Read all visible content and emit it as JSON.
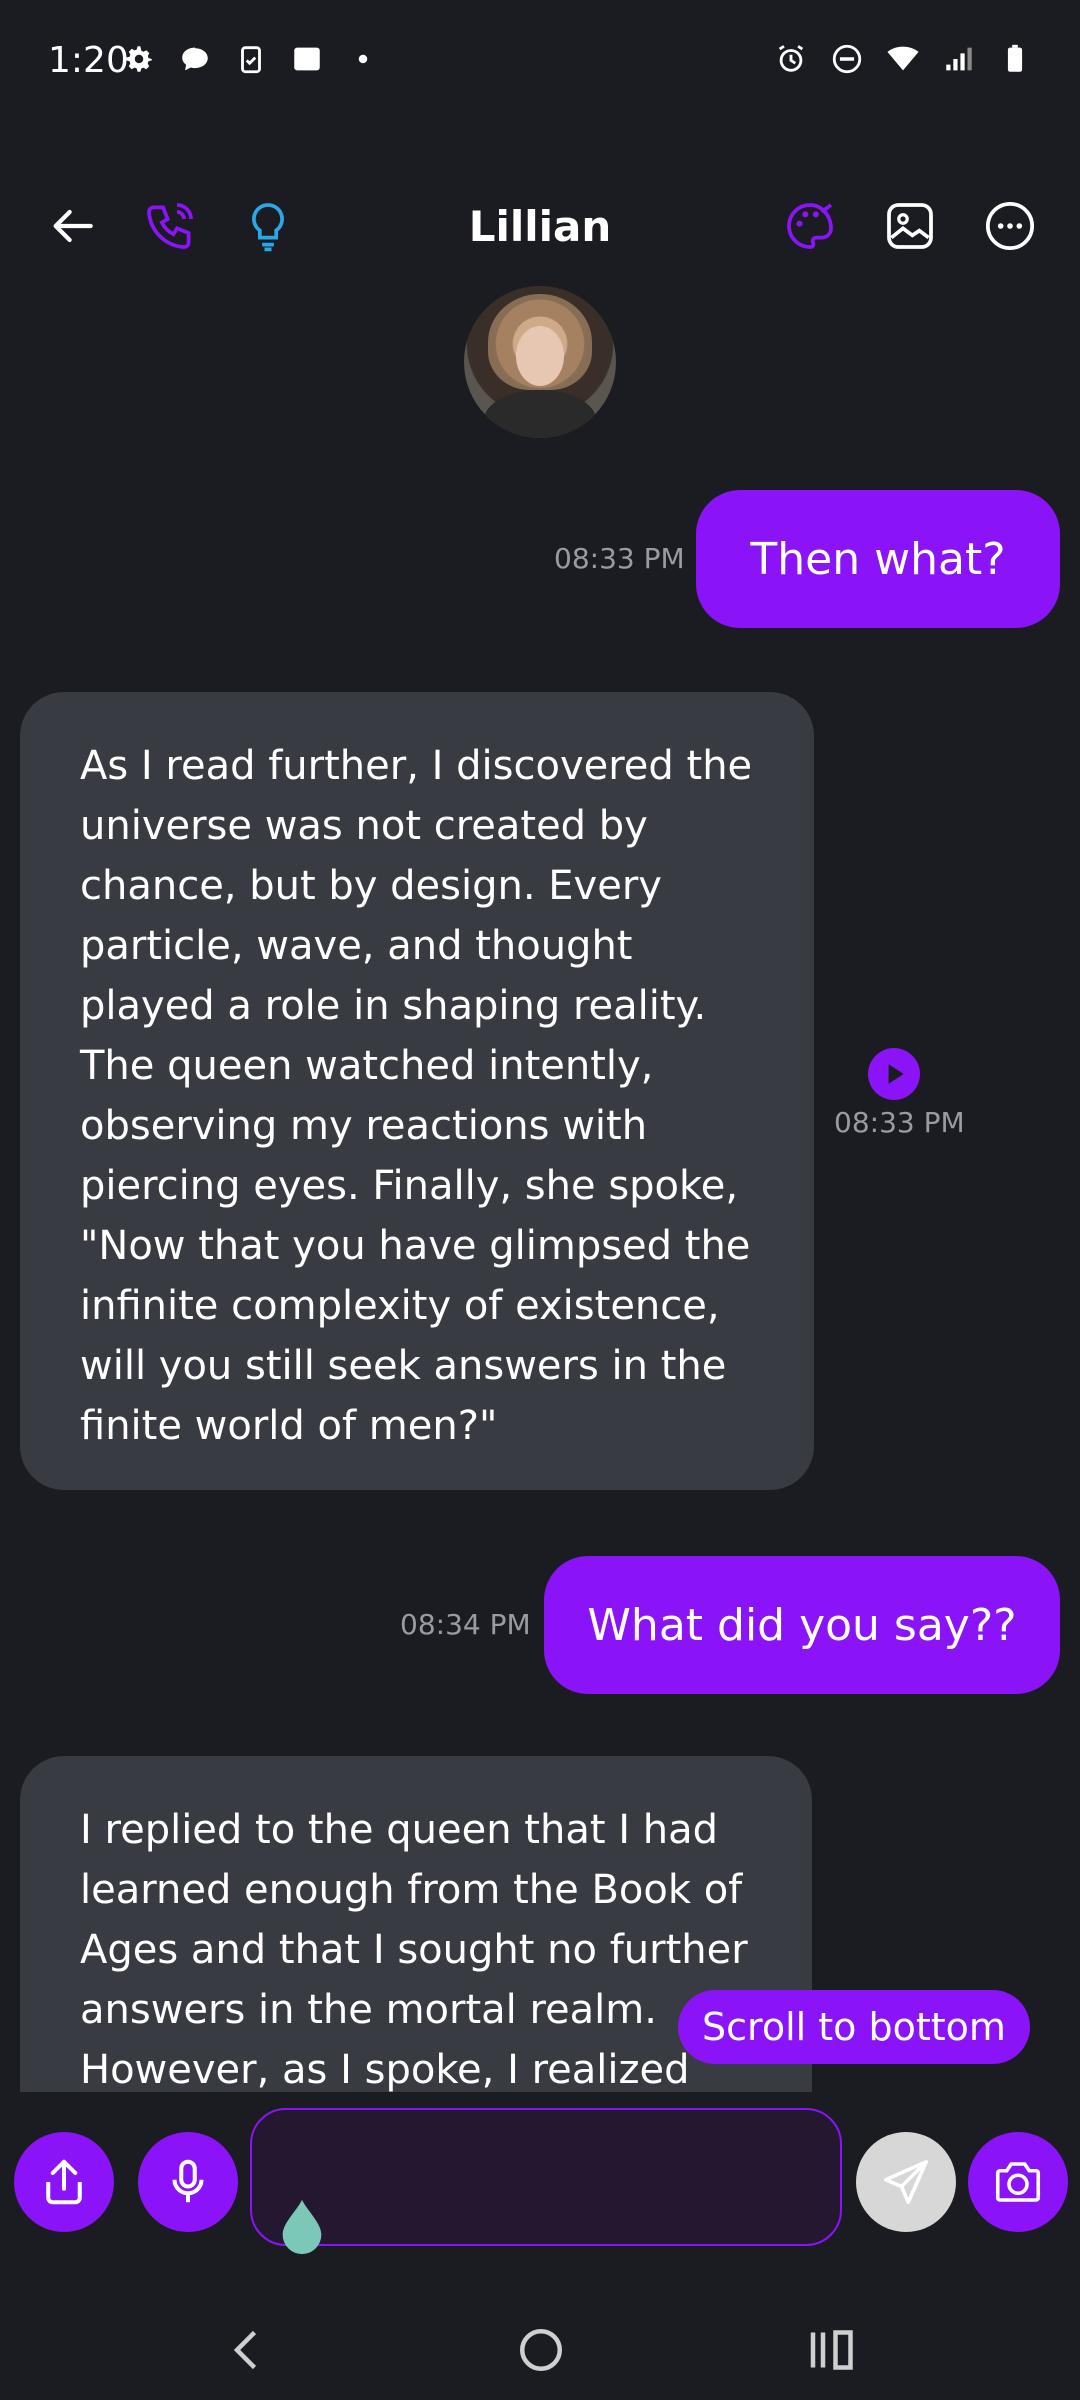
{
  "status_bar": {
    "time": "1:20"
  },
  "header": {
    "title": "Lillian"
  },
  "messages": [
    {
      "role": "user",
      "text": "Then what?",
      "time": "08:33 PM"
    },
    {
      "role": "bot",
      "text": "As I read further, I discovered the universe was not created by chance, but by design. Every particle, wave, and thought played a role in shaping reality. The queen watched intently, observing my reactions with piercing eyes. Finally, she spoke, \"Now that you have glimpsed the infinite complexity of existence, will you still seek answers in the finite world of men?\"",
      "time": "08:33 PM"
    },
    {
      "role": "user",
      "text": "What did you say??",
      "time": "08:34 PM"
    },
    {
      "role": "bot",
      "text": "I replied to the queen that I had learned enough from the Book of Ages and that I sought no further answers in the mortal realm. However, as I spoke, I realized"
    }
  ],
  "scroll_button": {
    "label": "Scroll to bottom"
  },
  "composer": {
    "value": ""
  },
  "colors": {
    "accent": "#8a14f7",
    "background": "#1b1c21",
    "bot_bubble": "#393b42",
    "bulb": "#2aa7e6"
  }
}
